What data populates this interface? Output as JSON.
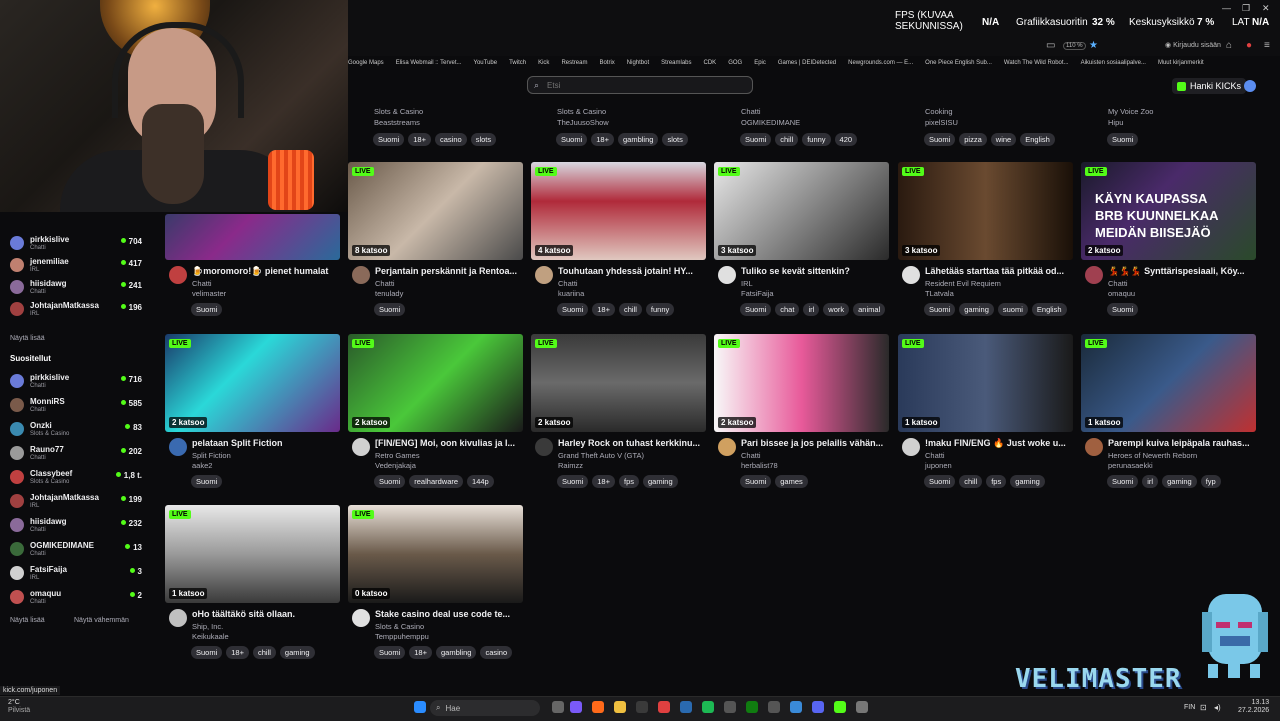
{
  "topbar": {
    "fps_label": "FPS (KUVAA SEKUNNISSA)",
    "fps_value": "N/A",
    "gpu_label": "Grafiikkasuoritin",
    "gpu_value": "32 %",
    "cpu_label": "Keskusyksikkö",
    "cpu_value": "7 %",
    "lat_label": "LAT",
    "lat_value": "N/A",
    "zoom": "110 %",
    "login": "Kirjaudu sisään"
  },
  "bookmarks": [
    "Google Maps",
    "Elisa Webmail :: Tervet...",
    "YouTube",
    "Twitch",
    "Kick",
    "Restream",
    "Botrix",
    "Nightbot",
    "Streamlabs",
    "CDK",
    "GOG",
    "Epic",
    "Games | DEIDetected",
    "Newgrounds.com — E...",
    "One Piece English Sub...",
    "Watch The Wild Robot...",
    "Aikuisten sosiaalipalve...",
    "Muut kirjanmerkit"
  ],
  "search": {
    "placeholder": "Etsi"
  },
  "kicks_button": "Hanki KICKs",
  "sidebar": {
    "recommended": [
      {
        "name": "pirkkislive",
        "cat": "Chatti",
        "count": "704",
        "color": "#6a7bd8"
      },
      {
        "name": "jenemiliae",
        "cat": "IRL",
        "count": "417",
        "color": "#c08070"
      },
      {
        "name": "hiisidawg",
        "cat": "Chatti",
        "count": "241",
        "color": "#8a6a9a"
      },
      {
        "name": "JohtajanMatkassa",
        "cat": "IRL",
        "count": "196",
        "color": "#a04040"
      }
    ],
    "show_more": "Näytä lisää",
    "followed_head": "Suositellut",
    "followed": [
      {
        "name": "pirkkislive",
        "cat": "Chatti",
        "count": "716",
        "color": "#6a7bd8"
      },
      {
        "name": "MonniRS",
        "cat": "Chatti",
        "count": "585",
        "color": "#7a5a4a"
      },
      {
        "name": "Onzki",
        "cat": "Slots & Casino",
        "count": "83",
        "color": "#3a8ab0"
      },
      {
        "name": "Rauno77",
        "cat": "Chatti",
        "count": "202",
        "color": "#9a9a9a"
      },
      {
        "name": "Classybeef",
        "cat": "Slots & Casino",
        "count": "1,8 t.",
        "color": "#c04040"
      },
      {
        "name": "JohtajanMatkassa",
        "cat": "IRL",
        "count": "199",
        "color": "#a04040"
      },
      {
        "name": "hiisidawg",
        "cat": "Chatti",
        "count": "232",
        "color": "#8a6a9a"
      },
      {
        "name": "OGMIKEDIMANE",
        "cat": "Chatti",
        "count": "13",
        "color": "#3a6a3a"
      },
      {
        "name": "FatsiFaija",
        "cat": "IRL",
        "count": "3",
        "color": "#d0d0d0"
      },
      {
        "name": "omaquu",
        "cat": "Chatti",
        "count": "2",
        "color": "#c05050"
      }
    ],
    "show_more2": "Näytä lisää",
    "show_less": "Näytä vähemmän"
  },
  "top_row": [
    {
      "cat": "Slots & Casino",
      "user": "Beaststreams",
      "tags": [
        "Suomi",
        "18+",
        "casino",
        "slots"
      ]
    },
    {
      "cat": "Slots & Casino",
      "user": "TheJuusoShow",
      "tags": [
        "Suomi",
        "18+",
        "gambling",
        "slots"
      ]
    },
    {
      "cat": "Chatti",
      "user": "OGMIKEDIMANE",
      "tags": [
        "Suomi",
        "chill",
        "funny",
        "420"
      ]
    },
    {
      "cat": "Cooking",
      "user": "pixelSISU",
      "tags": [
        "Suomi",
        "pizza",
        "wine",
        "English"
      ]
    },
    {
      "cat": "My Voice Zoo",
      "user": "Hipu",
      "tags": [
        "Suomi"
      ]
    }
  ],
  "cards": [
    {
      "viewers": "",
      "title": "🍺moromoro!🍺 pienet humalat",
      "cat": "Chatti",
      "user": "velimaster",
      "tags": [
        "Suomi"
      ],
      "live": false
    },
    {
      "viewers": "8 katsoo",
      "title": "Perjantain perskännit ja Rentoa...",
      "cat": "Chatti",
      "user": "tenulady",
      "tags": [
        "Suomi"
      ],
      "live": true
    },
    {
      "viewers": "4 katsoo",
      "title": "Touhutaan yhdessä jotain! HY...",
      "cat": "Chatti",
      "user": "kuariina",
      "tags": [
        "Suomi",
        "18+",
        "chill",
        "funny"
      ],
      "live": true
    },
    {
      "viewers": "3 katsoo",
      "title": "Tuliko se kevät sittenkin?",
      "cat": "IRL",
      "user": "FatsiFaija",
      "tags": [
        "Suomi",
        "chat",
        "irl",
        "work",
        "animal"
      ],
      "live": true
    },
    {
      "viewers": "3 katsoo",
      "title": "Lähetääs starttaa tää pitkää od...",
      "cat": "Resident Evil Requiem",
      "user": "TLatvala",
      "tags": [
        "Suomi",
        "gaming",
        "suomi",
        "English"
      ],
      "live": true
    },
    {
      "viewers": "2 katsoo",
      "title": "💃💃💃 Synttärispesiaali, Köy...",
      "cat": "Chatti",
      "user": "omaquu",
      "tags": [
        "Suomi"
      ],
      "live": true
    },
    {
      "viewers": "2 katsoo",
      "title": "pelataan Split Fiction",
      "cat": "Split Fiction",
      "user": "aake2",
      "tags": [
        "Suomi"
      ],
      "live": true
    },
    {
      "viewers": "2 katsoo",
      "title": "[FIN/ENG] Moi, oon kivulias ja l...",
      "cat": "Retro Games",
      "user": "Vedenjakaja",
      "tags": [
        "Suomi",
        "realhardware",
        "144p"
      ],
      "live": true
    },
    {
      "viewers": "2 katsoo",
      "title": "Harley Rock on tuhast kerkkinu...",
      "cat": "Grand Theft Auto V (GTA)",
      "user": "Raimzz",
      "tags": [
        "Suomi",
        "18+",
        "fps",
        "gaming"
      ],
      "live": true
    },
    {
      "viewers": "2 katsoo",
      "title": "Pari bissee ja jos pelailis vähän...",
      "cat": "Chatti",
      "user": "herbalist78",
      "tags": [
        "Suomi",
        "games"
      ],
      "live": true
    },
    {
      "viewers": "1 katsoo",
      "title": "!maku FIN/ENG 🔥 Just woke u...",
      "cat": "Chatti",
      "user": "juponen",
      "tags": [
        "Suomi",
        "chill",
        "fps",
        "gaming"
      ],
      "live": true
    },
    {
      "viewers": "1 katsoo",
      "title": "Parempi kuiva leipäpala rauhas...",
      "cat": "Heroes of Newerth Reborn",
      "user": "perunasaekki",
      "tags": [
        "Suomi",
        "irl",
        "gaming",
        "fyp"
      ],
      "live": true
    },
    {
      "viewers": "1 katsoo",
      "title": "oHo täältäkö sitä ollaan.",
      "cat": "Ship, Inc.",
      "user": "Keikukaale",
      "tags": [
        "Suomi",
        "18+",
        "chill",
        "gaming"
      ],
      "live": true
    },
    {
      "viewers": "0 katsoo",
      "title": "Stake casino deal use code te...",
      "cat": "Slots & Casino",
      "user": "Temppuhemppu",
      "tags": [
        "Suomi",
        "18+",
        "gambling",
        "casino"
      ],
      "live": true
    }
  ],
  "overlay_text": [
    "KÄYN KAUPASSA",
    "BRB KUUNNELKAA",
    "MEIDÄN BIISEJÄÖ"
  ],
  "status_url": "kick.com/juponen",
  "taskbar": {
    "weather_temp": "2°C",
    "weather_desc": "Pilvistä",
    "search": "Hae",
    "lang": "FIN",
    "time": "13.13",
    "date": "27.2.2026"
  },
  "branding": "VELIMASTER"
}
